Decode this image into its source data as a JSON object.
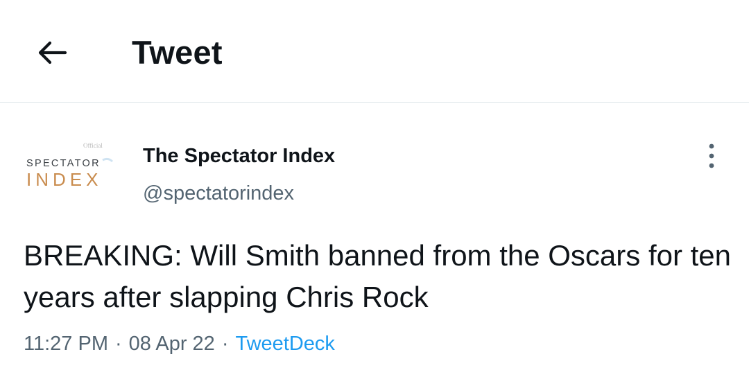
{
  "header": {
    "title": "Tweet",
    "back_icon": "arrow-left-icon"
  },
  "tweet": {
    "author": {
      "name": "The Spectator Index",
      "handle": "@spectatorindex",
      "avatar_text_top": "SPECTATOR",
      "avatar_text_bottom": "INDEX",
      "avatar_badge": "Official"
    },
    "more_icon": "more-vertical-icon",
    "text": "BREAKING: Will Smith banned from the Oscars for ten years after slapping Chris Rock",
    "time": "11:27 PM",
    "separator": "·",
    "date": "08 Apr 22",
    "source": "TweetDeck"
  },
  "colors": {
    "text_primary": "#0f1419",
    "text_secondary": "#536471",
    "link": "#1d9bf0",
    "divider": "#dde5e9",
    "logo_dark": "#3a3f44",
    "logo_accent": "#c98c4e"
  }
}
